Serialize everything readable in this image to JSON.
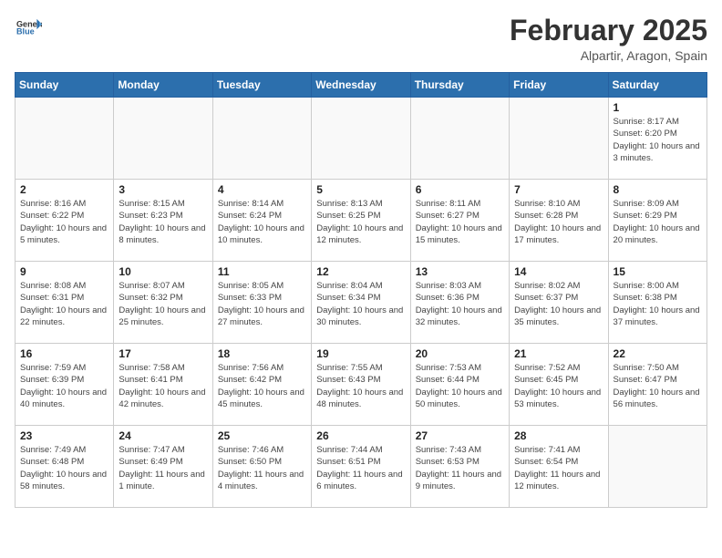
{
  "header": {
    "logo_general": "General",
    "logo_blue": "Blue",
    "title": "February 2025",
    "subtitle": "Alpartir, Aragon, Spain"
  },
  "weekdays": [
    "Sunday",
    "Monday",
    "Tuesday",
    "Wednesday",
    "Thursday",
    "Friday",
    "Saturday"
  ],
  "weeks": [
    [
      {
        "day": "",
        "info": ""
      },
      {
        "day": "",
        "info": ""
      },
      {
        "day": "",
        "info": ""
      },
      {
        "day": "",
        "info": ""
      },
      {
        "day": "",
        "info": ""
      },
      {
        "day": "",
        "info": ""
      },
      {
        "day": "1",
        "info": "Sunrise: 8:17 AM\nSunset: 6:20 PM\nDaylight: 10 hours and 3 minutes."
      }
    ],
    [
      {
        "day": "2",
        "info": "Sunrise: 8:16 AM\nSunset: 6:22 PM\nDaylight: 10 hours and 5 minutes."
      },
      {
        "day": "3",
        "info": "Sunrise: 8:15 AM\nSunset: 6:23 PM\nDaylight: 10 hours and 8 minutes."
      },
      {
        "day": "4",
        "info": "Sunrise: 8:14 AM\nSunset: 6:24 PM\nDaylight: 10 hours and 10 minutes."
      },
      {
        "day": "5",
        "info": "Sunrise: 8:13 AM\nSunset: 6:25 PM\nDaylight: 10 hours and 12 minutes."
      },
      {
        "day": "6",
        "info": "Sunrise: 8:11 AM\nSunset: 6:27 PM\nDaylight: 10 hours and 15 minutes."
      },
      {
        "day": "7",
        "info": "Sunrise: 8:10 AM\nSunset: 6:28 PM\nDaylight: 10 hours and 17 minutes."
      },
      {
        "day": "8",
        "info": "Sunrise: 8:09 AM\nSunset: 6:29 PM\nDaylight: 10 hours and 20 minutes."
      }
    ],
    [
      {
        "day": "9",
        "info": "Sunrise: 8:08 AM\nSunset: 6:31 PM\nDaylight: 10 hours and 22 minutes."
      },
      {
        "day": "10",
        "info": "Sunrise: 8:07 AM\nSunset: 6:32 PM\nDaylight: 10 hours and 25 minutes."
      },
      {
        "day": "11",
        "info": "Sunrise: 8:05 AM\nSunset: 6:33 PM\nDaylight: 10 hours and 27 minutes."
      },
      {
        "day": "12",
        "info": "Sunrise: 8:04 AM\nSunset: 6:34 PM\nDaylight: 10 hours and 30 minutes."
      },
      {
        "day": "13",
        "info": "Sunrise: 8:03 AM\nSunset: 6:36 PM\nDaylight: 10 hours and 32 minutes."
      },
      {
        "day": "14",
        "info": "Sunrise: 8:02 AM\nSunset: 6:37 PM\nDaylight: 10 hours and 35 minutes."
      },
      {
        "day": "15",
        "info": "Sunrise: 8:00 AM\nSunset: 6:38 PM\nDaylight: 10 hours and 37 minutes."
      }
    ],
    [
      {
        "day": "16",
        "info": "Sunrise: 7:59 AM\nSunset: 6:39 PM\nDaylight: 10 hours and 40 minutes."
      },
      {
        "day": "17",
        "info": "Sunrise: 7:58 AM\nSunset: 6:41 PM\nDaylight: 10 hours and 42 minutes."
      },
      {
        "day": "18",
        "info": "Sunrise: 7:56 AM\nSunset: 6:42 PM\nDaylight: 10 hours and 45 minutes."
      },
      {
        "day": "19",
        "info": "Sunrise: 7:55 AM\nSunset: 6:43 PM\nDaylight: 10 hours and 48 minutes."
      },
      {
        "day": "20",
        "info": "Sunrise: 7:53 AM\nSunset: 6:44 PM\nDaylight: 10 hours and 50 minutes."
      },
      {
        "day": "21",
        "info": "Sunrise: 7:52 AM\nSunset: 6:45 PM\nDaylight: 10 hours and 53 minutes."
      },
      {
        "day": "22",
        "info": "Sunrise: 7:50 AM\nSunset: 6:47 PM\nDaylight: 10 hours and 56 minutes."
      }
    ],
    [
      {
        "day": "23",
        "info": "Sunrise: 7:49 AM\nSunset: 6:48 PM\nDaylight: 10 hours and 58 minutes."
      },
      {
        "day": "24",
        "info": "Sunrise: 7:47 AM\nSunset: 6:49 PM\nDaylight: 11 hours and 1 minute."
      },
      {
        "day": "25",
        "info": "Sunrise: 7:46 AM\nSunset: 6:50 PM\nDaylight: 11 hours and 4 minutes."
      },
      {
        "day": "26",
        "info": "Sunrise: 7:44 AM\nSunset: 6:51 PM\nDaylight: 11 hours and 6 minutes."
      },
      {
        "day": "27",
        "info": "Sunrise: 7:43 AM\nSunset: 6:53 PM\nDaylight: 11 hours and 9 minutes."
      },
      {
        "day": "28",
        "info": "Sunrise: 7:41 AM\nSunset: 6:54 PM\nDaylight: 11 hours and 12 minutes."
      },
      {
        "day": "",
        "info": ""
      }
    ]
  ]
}
